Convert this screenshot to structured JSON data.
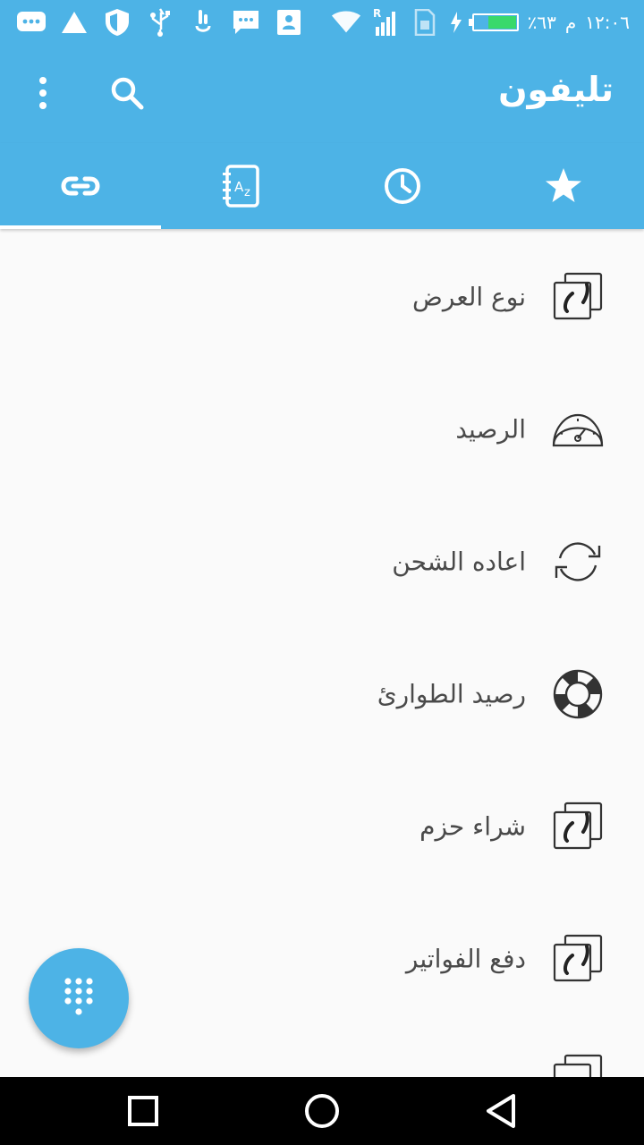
{
  "status_bar": {
    "time": "١٢:٠٦",
    "ampm": "م",
    "battery_text": "٪٦٣",
    "battery_level": 0.63,
    "battery_color": "#39d96b",
    "left_icons": [
      "chat-bubble-icon",
      "warning-icon",
      "shield-icon",
      "usb-icon",
      "touch-icon",
      "message-icon",
      "contact-card-icon"
    ],
    "right_icons": [
      "wifi-icon",
      "signal-roaming-icon",
      "sim-icon",
      "charging-icon"
    ]
  },
  "app_bar": {
    "title": "تليفون",
    "color": "#4db3e6"
  },
  "tabs": [
    {
      "icon": "link-icon",
      "active": true
    },
    {
      "icon": "contacts-az-icon",
      "active": false
    },
    {
      "icon": "clock-icon",
      "active": false
    },
    {
      "icon": "star-icon",
      "active": false
    }
  ],
  "list": {
    "items": [
      {
        "label": "نوع العرض",
        "icon": "phone-cards-icon"
      },
      {
        "label": "الرصيد",
        "icon": "speedometer-icon"
      },
      {
        "label": "اعاده الشحن",
        "icon": "refresh-icon"
      },
      {
        "label": "رصيد الطوارئ",
        "icon": "lifebuoy-icon"
      },
      {
        "label": "شراء حزم",
        "icon": "phone-cards-icon"
      },
      {
        "label": "دفع الفواتير",
        "icon": "phone-cards-icon"
      }
    ]
  },
  "fab": {
    "icon": "dialpad-icon"
  },
  "nav_bar": {
    "buttons": [
      "recents-button",
      "home-button",
      "back-button"
    ]
  }
}
